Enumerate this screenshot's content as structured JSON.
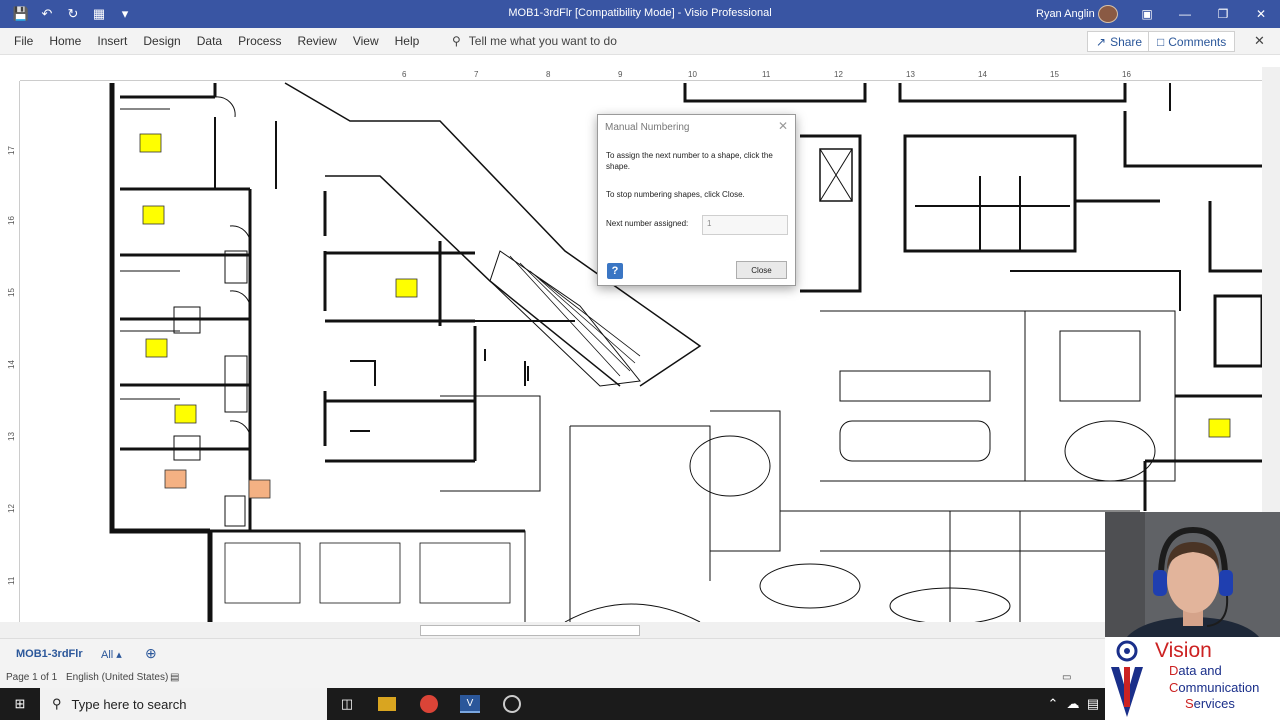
{
  "window": {
    "title": "MOB1-3rdFlr  [Compatibility Mode]  -  Visio Professional",
    "user_name": "Ryan Anglin"
  },
  "qat": {
    "save_icon": "save-icon",
    "undo_icon": "undo-icon",
    "redo_icon": "redo-icon",
    "customize_icon": "customize-icon"
  },
  "ribbon": {
    "tabs": [
      "File",
      "Home",
      "Insert",
      "Design",
      "Data",
      "Process",
      "Review",
      "View",
      "Help"
    ],
    "tell_me": "Tell me what you want to do",
    "share_label": "Share",
    "comments_label": "Comments"
  },
  "rulers": {
    "top_ticks": [
      "6",
      "7",
      "8",
      "9",
      "10",
      "11",
      "12",
      "13",
      "14",
      "15",
      "16"
    ],
    "left_ticks": [
      "17",
      "16",
      "15",
      "14",
      "13",
      "12",
      "11"
    ]
  },
  "dialog": {
    "title": "Manual Numbering",
    "text_assign": "To assign the next number to a shape, click the shape.",
    "text_stop": "To stop numbering shapes, click Close.",
    "next_number_label": "Next number assigned:",
    "next_number_value": "1",
    "close_label": "Close"
  },
  "pages": {
    "current_page": "MOB1-3rdFlr",
    "all_label": "All"
  },
  "status": {
    "page_info": "Page 1 of 1",
    "language": "English (United States)"
  },
  "taskbar": {
    "search_placeholder": "Type here to search"
  },
  "overlay": {
    "logo_line1": "Vision",
    "logo_line2": "ata and",
    "logo_line3": "ommunication",
    "logo_line4": "ervices",
    "logo_initial2": "D",
    "logo_initial3": "C",
    "logo_initial4": "S"
  },
  "colors": {
    "title_bar": "#3955a3",
    "marker_yellow": "#ffff00",
    "marker_orange": "#f4b183",
    "logo_red": "#cc2222",
    "logo_blue": "#1a2f8a"
  }
}
